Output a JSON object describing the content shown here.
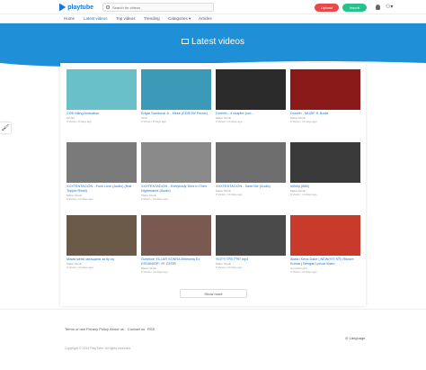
{
  "header": {
    "logo_text": "playtube",
    "search_placeholder": "Search for videos",
    "upload_label": "Upload",
    "import_label": "Import"
  },
  "nav": {
    "items": [
      "Home",
      "Latest videos",
      "Top videos",
      "Trending",
      "Categories ▾",
      "Articles"
    ]
  },
  "page": {
    "title": "Latest videos",
    "show_more": "Show more"
  },
  "videos": [
    {
      "title": "COD Idling Animation",
      "channel": "xander",
      "meta": "0 Views • 8 days ago",
      "thumb_color": "#6ac0c9"
    },
    {
      "title": "Edgar Sandoval Jr - Mese (EDROW Remix)",
      "channel": "Abrar",
      "meta": "0 Views • 8 days ago",
      "thumb_color": "#3a9ab8"
    },
    {
      "title": "Dorreth - 4 chapter (cre...",
      "channel": "Maker Musik",
      "meta": "0 Views • 14 days ago",
      "thumb_color": "#2a2a2a"
    },
    {
      "title": "Dorreth - MUZIF ft. Bodie",
      "channel": "Maker Musik",
      "meta": "0 Views • 14 days ago",
      "thumb_color": "#8a1a1a"
    },
    {
      "title": "XXXTENTACION - Fuck Love (Audio) (feat. Trippie Redd)",
      "channel": "Maker Musik",
      "meta": "0 Views • 14 days ago",
      "thumb_color": "#7a7a7a"
    },
    {
      "title": "XXXTENTACION - Everybody Dies In Their Nightmares (Audio)",
      "channel": "Maker Musik",
      "meta": "0 Views • 14 days ago",
      "thumb_color": "#8a8a8a"
    },
    {
      "title": "XXXTENTACION - Save Me (Audio)",
      "channel": "Maker Musik",
      "meta": "0 Views • 14 days ago",
      "thumb_color": "#6e6e6e"
    },
    {
      "title": "Infinity (888)",
      "channel": "Maker Musik",
      "meta": "0 Views • 14 days ago",
      "thumb_color": "#3a3a3a"
    },
    {
      "title": "Мама меня затащила за Кр ку",
      "channel": "Maker Musik",
      "meta": "0 Views • 14 days ago",
      "thumb_color": "#6b5a48"
    },
    {
      "title": "Özbekce YILLAR SONRA Birlesmiş Ex ESSANIOR: YE CESE!",
      "channel": "Maker Musik",
      "meta": "0 Views • 14 days ago",
      "thumb_color": "#7a5a50"
    },
    {
      "title": "করোনা প্রথম শিক্ষা mp4",
      "channel": "Maker Musik",
      "meta": "0 Views • 14 days ago",
      "thumb_color": "#4a4a4a"
    },
    {
      "title": "Akash Kena Dake | NEW(ভাব ছবি) Ritosre Kumar | Bengali Lyrical Video",
      "channel": "somewsh ghd",
      "meta": "0 Views • 14 days ago",
      "thumb_color": "#c83a2a"
    }
  ],
  "footer": {
    "links": [
      "Terms of use",
      "Privacy Policy",
      "About us",
      "Contact us",
      "RSS"
    ],
    "copyright": "Copyright © 2019 PlayTube. All rights reserved.",
    "language": "Language"
  }
}
